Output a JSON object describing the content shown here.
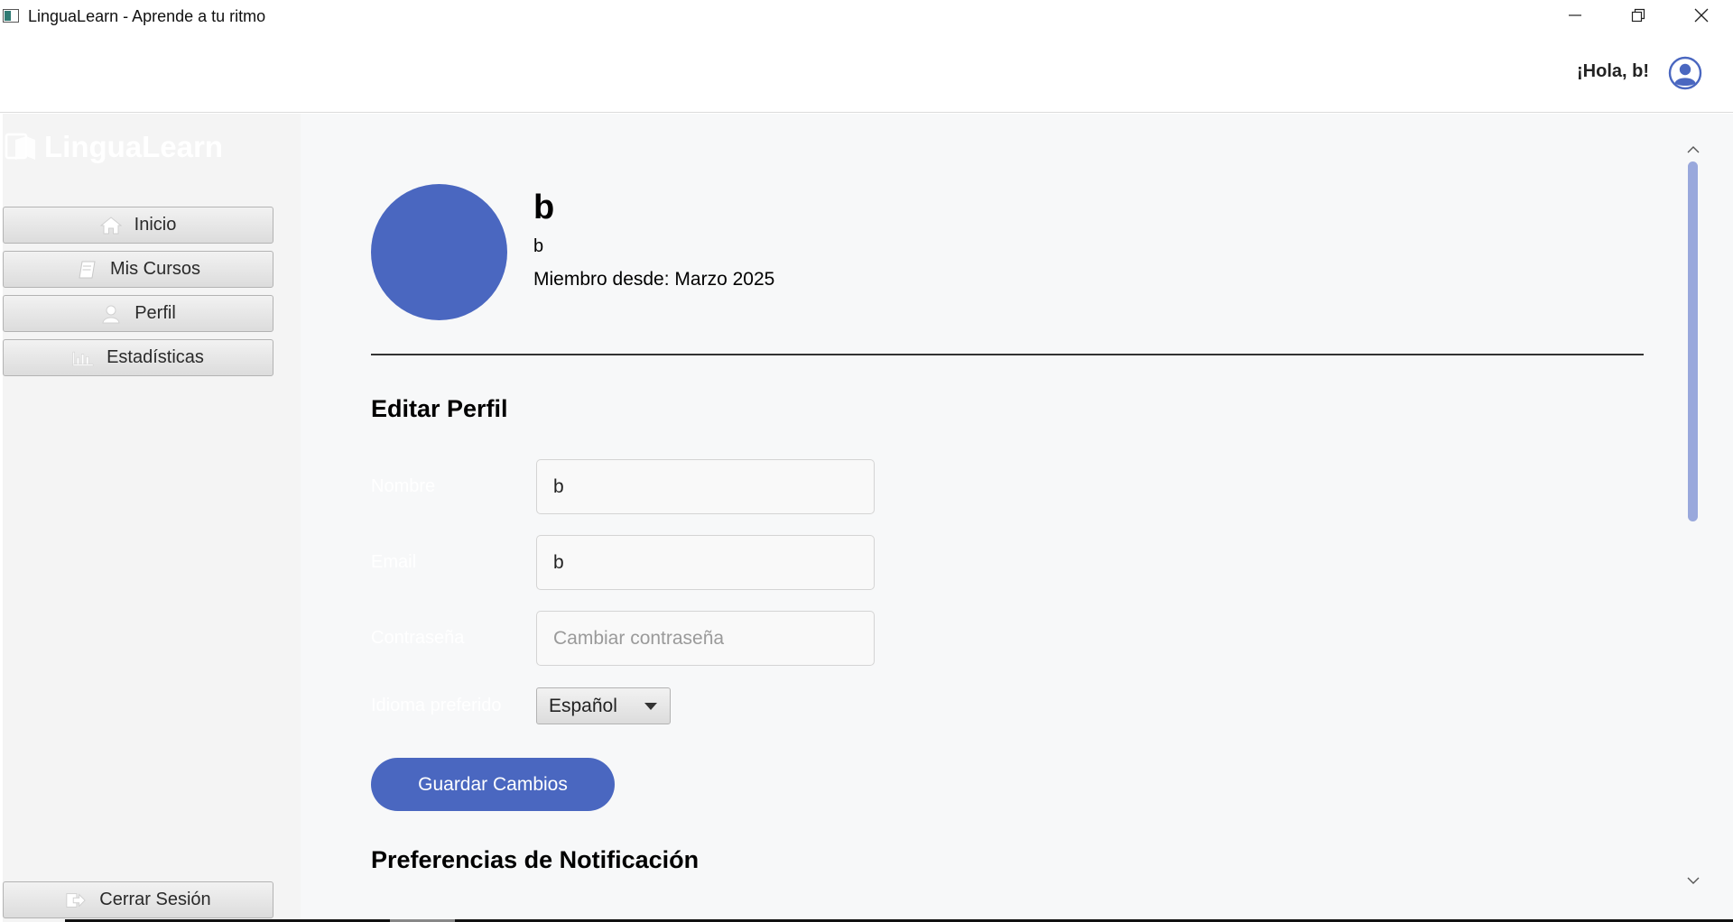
{
  "window": {
    "title": "LinguaLearn - Aprende a tu ritmo"
  },
  "header": {
    "greeting": "¡Hola, b!"
  },
  "sidebar": {
    "brand": "LinguaLearn",
    "items": [
      {
        "label": "Inicio",
        "icon": "home-icon"
      },
      {
        "label": "Mis Cursos",
        "icon": "book-icon"
      },
      {
        "label": "Perfil",
        "icon": "user-icon"
      },
      {
        "label": "Estadísticas",
        "icon": "bar-chart-icon"
      }
    ],
    "logout_label": "Cerrar Sesión"
  },
  "profile": {
    "name": "b",
    "username": "b",
    "member_since": "Miembro desde: Marzo 2025"
  },
  "edit_profile": {
    "title": "Editar Perfil",
    "name_label": "Nombre",
    "name_value": "b",
    "email_label": "Email",
    "email_value": "b",
    "password_label": "Contraseña",
    "password_placeholder": "Cambiar contraseña",
    "language_label": "Idioma preferido",
    "language_value": "Español",
    "save_label": "Guardar Cambios"
  },
  "notifications": {
    "title": "Preferencias de Notificación"
  },
  "colors": {
    "accent": "#4a67c0",
    "scrollbar": "#99a8dc",
    "content_bg": "#f7f8f9",
    "sidebar_bg": "#f4f4f4"
  }
}
